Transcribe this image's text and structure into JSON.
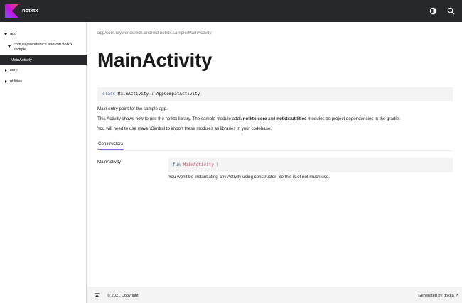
{
  "header": {
    "title": "notktx",
    "logo_icon": "kotlin-logo",
    "icons": [
      "theme-toggle-icon",
      "search-icon"
    ]
  },
  "sidebar": {
    "app": "app",
    "package": "com.raywenderlich.android.notktx.\nsample",
    "selected": "MainActivity",
    "core": "core",
    "utilities": "utilities"
  },
  "main": {
    "breadcrumb": "app/com.raywenderlich.android.notktx.sample/MainActivity",
    "title": "MainActivity",
    "signature": {
      "keyword": "class",
      "rest": " MainActivity : AppCompatActivity"
    },
    "p1": "Main entry point for the sample app.",
    "p2": {
      "pre": "This Activity shows how to use the notktx library. The sample module adds ",
      "b1": "notktx:core",
      "mid": " and ",
      "b2": "notktx:utilities",
      "post": " modules as project dependencies in the gradle."
    },
    "p3": "You will need to use mavenCentral to import these modules as libraries in your codebase.",
    "tab": "Constructors",
    "member": {
      "name": "MainActivity",
      "keyword": "fun",
      "fn": "MainActivity",
      "parens": "()",
      "desc": "You won't be instantiating any Activity using constructor. So this is of not much use."
    }
  },
  "footer": {
    "copyright": "© 2021 Copyright",
    "generated": "Generated by dokka ↗"
  },
  "colors": {
    "topbar": "#27282c",
    "accent": "#8e63d9",
    "keyword": "#2f5faa",
    "function": "#c24a63",
    "code_bg": "#f4f4f5"
  }
}
